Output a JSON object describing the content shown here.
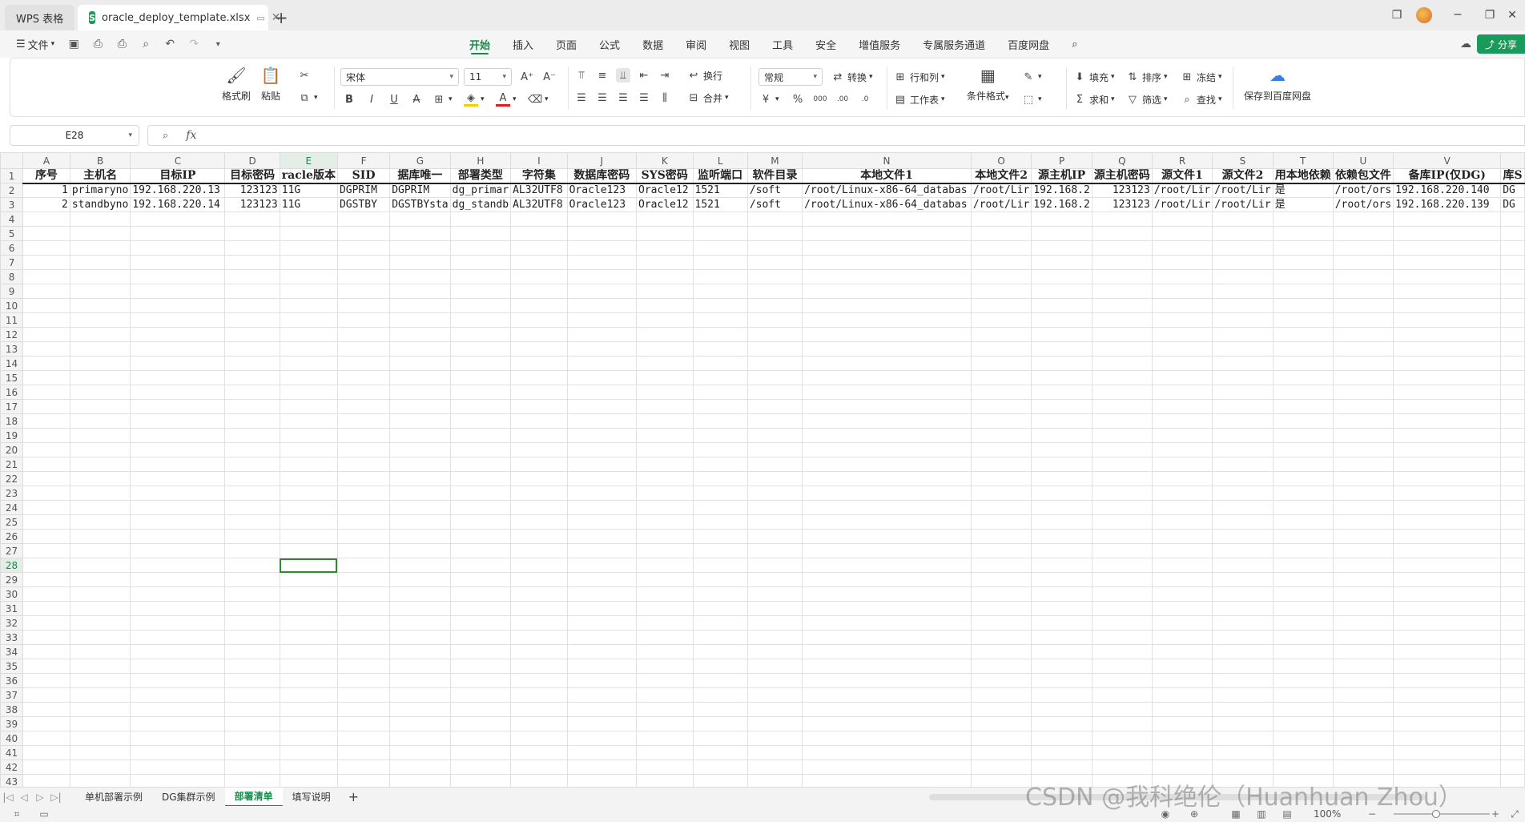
{
  "window": {
    "app_tab": "WPS 表格",
    "doc_tab": "oracle_deploy_template.xlsx"
  },
  "menu": {
    "file": "文件",
    "ribbon_tabs": [
      "开始",
      "插入",
      "页面",
      "公式",
      "数据",
      "审阅",
      "视图",
      "工具",
      "安全",
      "增值服务",
      "专属服务通道",
      "百度网盘"
    ],
    "share": "分享"
  },
  "ribbon": {
    "format_painter": "格式刷",
    "paste": "粘贴",
    "font_name": "宋体",
    "font_size": "11",
    "wrap": "换行",
    "merge": "合并",
    "number_format": "常规",
    "convert": "转换",
    "rows_cols": "行和列",
    "worksheet": "工作表",
    "cond_format": "条件格式",
    "fill": "填充",
    "sort": "排序",
    "freeze": "冻结",
    "sum": "求和",
    "filter": "筛选",
    "find": "查找",
    "save_baidu": "保存到百度网盘",
    "currency": "¥",
    "percent": "%"
  },
  "formula": {
    "cell_ref": "E28",
    "fx": "fx",
    "value": ""
  },
  "grid": {
    "columns": [
      "A",
      "B",
      "C",
      "D",
      "E",
      "F",
      "G",
      "H",
      "I",
      "J",
      "K",
      "L",
      "M",
      "N",
      "O",
      "P",
      "Q",
      "R",
      "S",
      "T",
      "U",
      "V",
      ""
    ],
    "header_row": [
      "序号",
      "主机名",
      "目标IP",
      "目标密码",
      "racle版本",
      "SID",
      "据库唯一",
      "部署类型",
      "字符集",
      "数据库密码",
      "SYS密码",
      "监听端口",
      "软件目录",
      "本地文件1",
      "本地文件2",
      "源主机IP",
      "源主机密码",
      "源文件1",
      "源文件2",
      "用本地依赖",
      "依赖包文件",
      "备库IP(仅DG)",
      "库S"
    ],
    "rows": [
      [
        "1",
        "primaryno",
        "192.168.220.13",
        "123123",
        "11G",
        "DGPRIM",
        "DGPRIM",
        "dg_primar",
        "AL32UTF8",
        "Oracle123",
        "Oracle12",
        "1521",
        "/soft",
        "/root/Linux-x86-64_databas",
        "/root/Lir",
        "192.168.2",
        "123123",
        "/root/Lir",
        "/root/Lir",
        "是",
        "/root/ors",
        "192.168.220.140",
        "DG"
      ],
      [
        "2",
        "standbyno",
        "192.168.220.14",
        "123123",
        "11G",
        "DGSTBY",
        "DGSTBYsta",
        "dg_standb",
        "AL32UTF8",
        "Oracle123",
        "Oracle12",
        "1521",
        "/soft",
        "/root/Linux-x86-64_databas",
        "/root/Lir",
        "192.168.2",
        "123123",
        "/root/Lir",
        "/root/Lir",
        "是",
        "/root/ors",
        "192.168.220.139",
        "DG"
      ]
    ],
    "row_count": 43
  },
  "sheets": {
    "tabs": [
      "单机部署示例",
      "DG集群示例",
      "部署清单",
      "填写说明"
    ],
    "active": "部署清单"
  },
  "status": {
    "zoom": "100%"
  },
  "watermark": "CSDN @我科绝伦（Huanhuan Zhou）"
}
